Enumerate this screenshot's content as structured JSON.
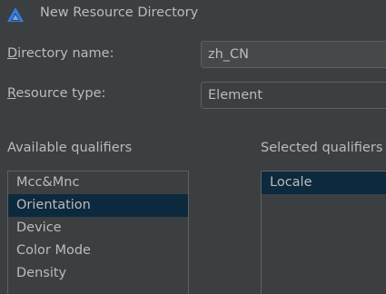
{
  "dialog": {
    "title": "New Resource Directory",
    "icon": "harmony-app-icon"
  },
  "form": {
    "directory_name": {
      "label_mnemonic": "D",
      "label_rest": "irectory name:",
      "value": "zh_CN"
    },
    "resource_type": {
      "label_mnemonic": "R",
      "label_rest": "esource type:",
      "value": "Element"
    }
  },
  "available_qualifiers": {
    "label": "Available qualifiers",
    "items": [
      "Mcc&Mnc",
      "Orientation",
      "Device",
      "Color Mode",
      "Density"
    ],
    "selected_index": 1
  },
  "selected_qualifiers": {
    "label": "Selected qualifiers",
    "items": [
      "Locale"
    ],
    "selected_index": 0
  },
  "colors": {
    "background": "#3c3f41",
    "selection": "#0d293e",
    "text": "#bbbbbb",
    "border": "#5e6060",
    "icon_blue": "#2f7fe6"
  }
}
